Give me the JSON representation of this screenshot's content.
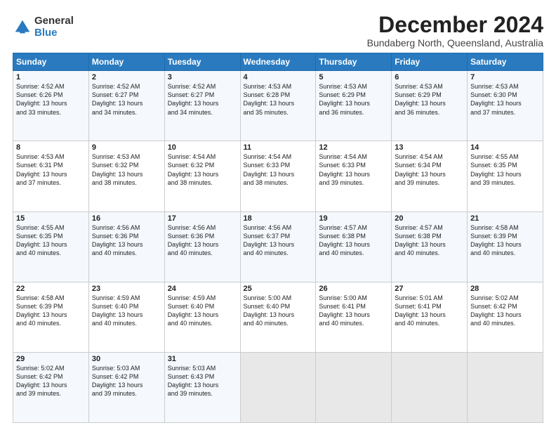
{
  "logo": {
    "general": "General",
    "blue": "Blue"
  },
  "title": "December 2024",
  "subtitle": "Bundaberg North, Queensland, Australia",
  "headers": [
    "Sunday",
    "Monday",
    "Tuesday",
    "Wednesday",
    "Thursday",
    "Friday",
    "Saturday"
  ],
  "weeks": [
    [
      {
        "num": "1",
        "detail": "Sunrise: 4:52 AM\nSunset: 6:26 PM\nDaylight: 13 hours\nand 33 minutes."
      },
      {
        "num": "2",
        "detail": "Sunrise: 4:52 AM\nSunset: 6:27 PM\nDaylight: 13 hours\nand 34 minutes."
      },
      {
        "num": "3",
        "detail": "Sunrise: 4:52 AM\nSunset: 6:27 PM\nDaylight: 13 hours\nand 34 minutes."
      },
      {
        "num": "4",
        "detail": "Sunrise: 4:53 AM\nSunset: 6:28 PM\nDaylight: 13 hours\nand 35 minutes."
      },
      {
        "num": "5",
        "detail": "Sunrise: 4:53 AM\nSunset: 6:29 PM\nDaylight: 13 hours\nand 36 minutes."
      },
      {
        "num": "6",
        "detail": "Sunrise: 4:53 AM\nSunset: 6:29 PM\nDaylight: 13 hours\nand 36 minutes."
      },
      {
        "num": "7",
        "detail": "Sunrise: 4:53 AM\nSunset: 6:30 PM\nDaylight: 13 hours\nand 37 minutes."
      }
    ],
    [
      {
        "num": "8",
        "detail": "Sunrise: 4:53 AM\nSunset: 6:31 PM\nDaylight: 13 hours\nand 37 minutes."
      },
      {
        "num": "9",
        "detail": "Sunrise: 4:53 AM\nSunset: 6:32 PM\nDaylight: 13 hours\nand 38 minutes."
      },
      {
        "num": "10",
        "detail": "Sunrise: 4:54 AM\nSunset: 6:32 PM\nDaylight: 13 hours\nand 38 minutes."
      },
      {
        "num": "11",
        "detail": "Sunrise: 4:54 AM\nSunset: 6:33 PM\nDaylight: 13 hours\nand 38 minutes."
      },
      {
        "num": "12",
        "detail": "Sunrise: 4:54 AM\nSunset: 6:33 PM\nDaylight: 13 hours\nand 39 minutes."
      },
      {
        "num": "13",
        "detail": "Sunrise: 4:54 AM\nSunset: 6:34 PM\nDaylight: 13 hours\nand 39 minutes."
      },
      {
        "num": "14",
        "detail": "Sunrise: 4:55 AM\nSunset: 6:35 PM\nDaylight: 13 hours\nand 39 minutes."
      }
    ],
    [
      {
        "num": "15",
        "detail": "Sunrise: 4:55 AM\nSunset: 6:35 PM\nDaylight: 13 hours\nand 40 minutes."
      },
      {
        "num": "16",
        "detail": "Sunrise: 4:56 AM\nSunset: 6:36 PM\nDaylight: 13 hours\nand 40 minutes."
      },
      {
        "num": "17",
        "detail": "Sunrise: 4:56 AM\nSunset: 6:36 PM\nDaylight: 13 hours\nand 40 minutes."
      },
      {
        "num": "18",
        "detail": "Sunrise: 4:56 AM\nSunset: 6:37 PM\nDaylight: 13 hours\nand 40 minutes."
      },
      {
        "num": "19",
        "detail": "Sunrise: 4:57 AM\nSunset: 6:38 PM\nDaylight: 13 hours\nand 40 minutes."
      },
      {
        "num": "20",
        "detail": "Sunrise: 4:57 AM\nSunset: 6:38 PM\nDaylight: 13 hours\nand 40 minutes."
      },
      {
        "num": "21",
        "detail": "Sunrise: 4:58 AM\nSunset: 6:39 PM\nDaylight: 13 hours\nand 40 minutes."
      }
    ],
    [
      {
        "num": "22",
        "detail": "Sunrise: 4:58 AM\nSunset: 6:39 PM\nDaylight: 13 hours\nand 40 minutes."
      },
      {
        "num": "23",
        "detail": "Sunrise: 4:59 AM\nSunset: 6:40 PM\nDaylight: 13 hours\nand 40 minutes."
      },
      {
        "num": "24",
        "detail": "Sunrise: 4:59 AM\nSunset: 6:40 PM\nDaylight: 13 hours\nand 40 minutes."
      },
      {
        "num": "25",
        "detail": "Sunrise: 5:00 AM\nSunset: 6:40 PM\nDaylight: 13 hours\nand 40 minutes."
      },
      {
        "num": "26",
        "detail": "Sunrise: 5:00 AM\nSunset: 6:41 PM\nDaylight: 13 hours\nand 40 minutes."
      },
      {
        "num": "27",
        "detail": "Sunrise: 5:01 AM\nSunset: 6:41 PM\nDaylight: 13 hours\nand 40 minutes."
      },
      {
        "num": "28",
        "detail": "Sunrise: 5:02 AM\nSunset: 6:42 PM\nDaylight: 13 hours\nand 40 minutes."
      }
    ],
    [
      {
        "num": "29",
        "detail": "Sunrise: 5:02 AM\nSunset: 6:42 PM\nDaylight: 13 hours\nand 39 minutes."
      },
      {
        "num": "30",
        "detail": "Sunrise: 5:03 AM\nSunset: 6:42 PM\nDaylight: 13 hours\nand 39 minutes."
      },
      {
        "num": "31",
        "detail": "Sunrise: 5:03 AM\nSunset: 6:43 PM\nDaylight: 13 hours\nand 39 minutes."
      },
      {
        "num": "",
        "detail": ""
      },
      {
        "num": "",
        "detail": ""
      },
      {
        "num": "",
        "detail": ""
      },
      {
        "num": "",
        "detail": ""
      }
    ]
  ]
}
